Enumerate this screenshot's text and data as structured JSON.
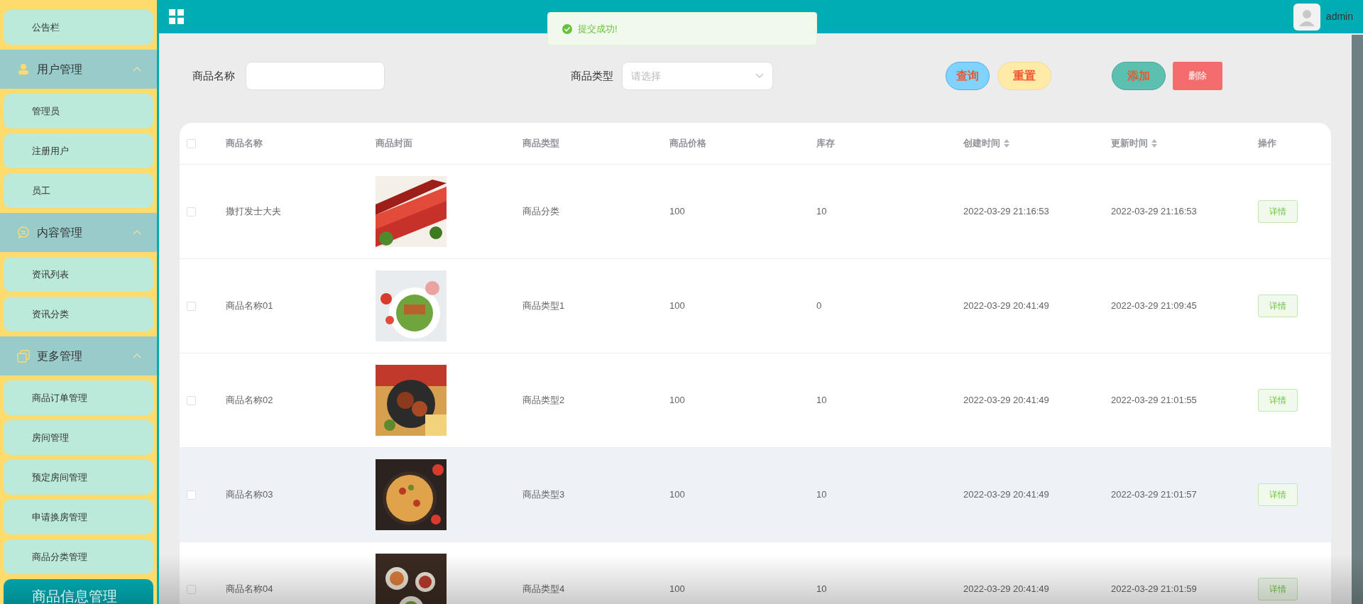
{
  "sidebar": {
    "items": [
      {
        "kind": "item",
        "label": "公告栏",
        "selected": false
      },
      {
        "kind": "group",
        "label": "用户管理",
        "expanded": true,
        "children": [
          {
            "label": "管理员",
            "selected": false
          },
          {
            "label": "注册用户",
            "selected": false
          },
          {
            "label": "员工",
            "selected": false
          }
        ]
      },
      {
        "kind": "group",
        "label": "内容管理",
        "expanded": true,
        "children": [
          {
            "label": "资讯列表",
            "selected": false
          },
          {
            "label": "资讯分类",
            "selected": false
          }
        ]
      },
      {
        "kind": "group",
        "label": "更多管理",
        "expanded": true,
        "children": [
          {
            "label": "商品订单管理",
            "selected": false
          },
          {
            "label": "房间管理",
            "selected": false
          },
          {
            "label": "预定房间管理",
            "selected": false
          },
          {
            "label": "申请换房管理",
            "selected": false
          },
          {
            "label": "商品分类管理",
            "selected": false
          }
        ]
      },
      {
        "kind": "item",
        "label": "商品信息管理",
        "selected": true
      }
    ]
  },
  "header": {
    "user": "admin"
  },
  "toast": {
    "message": "提交成功!"
  },
  "search": {
    "name_label": "商品名称",
    "type_label": "商品类型",
    "type_placeholder": "请选择",
    "buttons": [
      {
        "label": "查询",
        "kind": "query"
      },
      {
        "label": "重置",
        "kind": "reset"
      },
      {
        "label": "添加",
        "kind": "add"
      },
      {
        "label": "删除",
        "kind": "delete"
      }
    ]
  },
  "table": {
    "select_all": false,
    "columns": [
      {
        "label": "商品名称",
        "kind": "plain"
      },
      {
        "label": "商品封面",
        "kind": "plain"
      },
      {
        "label": "商品类型",
        "kind": "plain"
      },
      {
        "label": "商品价格",
        "kind": "plain"
      },
      {
        "label": "库存",
        "kind": "plain"
      },
      {
        "label": "创建时间",
        "kind": "sortable"
      },
      {
        "label": "更新时间",
        "kind": "sortable"
      },
      {
        "label": "操作",
        "kind": "plain"
      }
    ],
    "rows": [
      {
        "checked": false,
        "highlighted": false,
        "name": "撒打发士大夫",
        "type": "商品分类",
        "price": "100",
        "stock": "10",
        "created": "2022-03-29 21:16:53",
        "updated": "2022-03-29 21:16:53",
        "action": "详情"
      },
      {
        "checked": false,
        "highlighted": false,
        "name": "商品名称01",
        "type": "商品类型1",
        "price": "100",
        "stock": "0",
        "created": "2022-03-29 20:41:49",
        "updated": "2022-03-29 21:09:45",
        "action": "详情"
      },
      {
        "checked": false,
        "highlighted": false,
        "name": "商品名称02",
        "type": "商品类型2",
        "price": "100",
        "stock": "10",
        "created": "2022-03-29 20:41:49",
        "updated": "2022-03-29 21:01:55",
        "action": "详情"
      },
      {
        "checked": false,
        "highlighted": true,
        "name": "商品名称03",
        "type": "商品类型3",
        "price": "100",
        "stock": "10",
        "created": "2022-03-29 20:41:49",
        "updated": "2022-03-29 21:01:57",
        "action": "详情"
      },
      {
        "checked": false,
        "highlighted": false,
        "name": "商品名称04",
        "type": "商品类型4",
        "price": "100",
        "stock": "10",
        "created": "2022-03-29 20:41:49",
        "updated": "2022-03-29 21:01:59",
        "action": "详情"
      }
    ]
  }
}
